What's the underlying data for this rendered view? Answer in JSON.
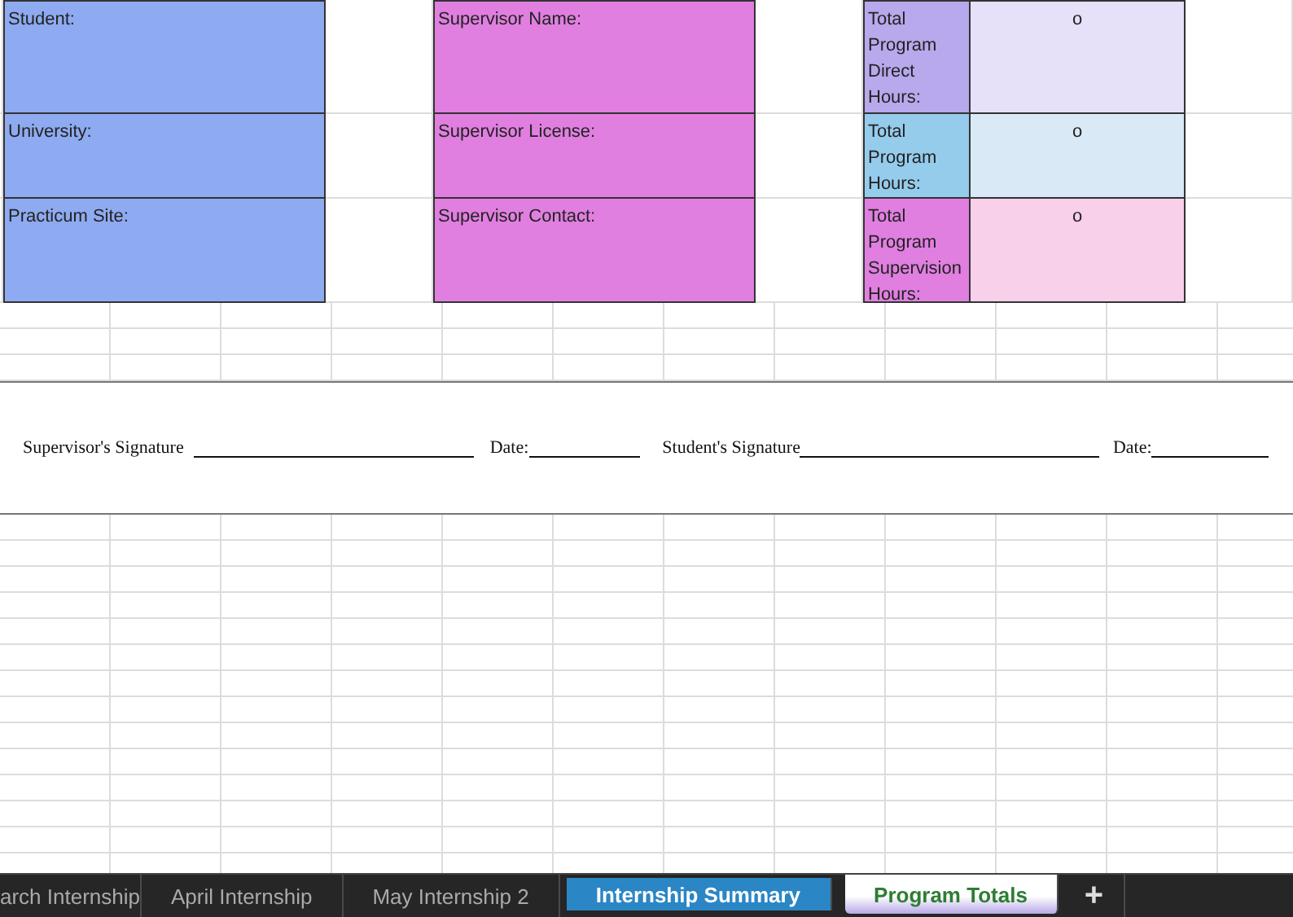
{
  "info_rows": [
    {
      "left_label": "Student:",
      "middle_label": "Supervisor Name:",
      "total_label": {
        "text": "Total Program Direct Hours:",
        "color": "#b8a8ec"
      },
      "total_value": {
        "text": "o",
        "color": "#e6e0f8"
      }
    },
    {
      "left_label": "University:",
      "middle_label": "Supervisor License:",
      "total_label": {
        "text": "Total Program Hours:",
        "color": "#95cbeb"
      },
      "total_value": {
        "text": "o",
        "color": "#d9eaf6"
      }
    },
    {
      "left_label": "Practicum Site:",
      "middle_label": "Supervisor Contact:",
      "total_label": {
        "text": "Total Program Supervision Hours:",
        "color": "#e07fe0"
      },
      "total_value": {
        "text": "o",
        "color": "#f8d0ea"
      }
    }
  ],
  "signature_line": {
    "supervisor_label": "Supervisor's Signature",
    "date_label_1": "Date:",
    "student_label": "Student's Signature",
    "date_label_2": "Date:"
  },
  "sheet_tabs": [
    {
      "label": "arch Internship",
      "selected": false
    },
    {
      "label": "April Internship",
      "selected": false
    },
    {
      "label": "May Internship 2",
      "selected": false
    },
    {
      "label": "Internship Summary",
      "selected": false,
      "color": "#2a86c4"
    },
    {
      "label": "Program Totals",
      "selected": true,
      "color": "#b9a9e8"
    }
  ],
  "add_sheet": "+"
}
